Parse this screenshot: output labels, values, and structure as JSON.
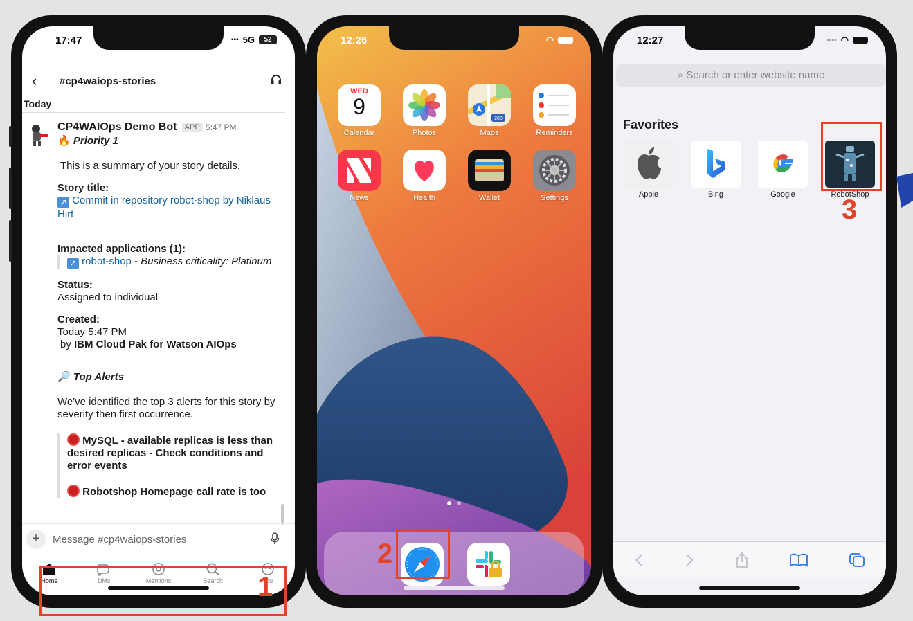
{
  "slack": {
    "status_time": "17:47",
    "network": "5G",
    "battery": "52",
    "channel": "#cp4waiops-stories",
    "day_label": "Today",
    "bot_name": "CP4WAIOps Demo Bot",
    "app_tag": "APP",
    "msg_time": "5:47 PM",
    "priority": "Priority 1",
    "summary": "This is a summary of your story details.",
    "story_title_label": "Story title:",
    "story_title_link": "Commit in repository robot-shop by Niklaus Hirt",
    "impacted_label": "Impacted applications (1):",
    "app_link": "robot-shop",
    "app_sep": " - ",
    "criticality": "Business criticality: Platinum",
    "status_label": "Status:",
    "status_value": "Assigned to individual",
    "created_label": "Created:",
    "created_value": "Today 5:47 PM",
    "by_prefix": "by",
    "by_value": "IBM Cloud Pak for Watson AIOps",
    "top_alerts": "Top Alerts",
    "alerts_intro": "We've identified the top 3 alerts for this story by severity then first occurrence.",
    "alert1": "MySQL - available replicas is less than desired replicas - Check conditions and error events",
    "alert2": "Robotshop Homepage call rate is too",
    "composer_placeholder": "Message #cp4waiops-stories",
    "tabs": [
      "Home",
      "DMs",
      "Mentions",
      "Search",
      "You"
    ]
  },
  "home": {
    "status_time": "12:26",
    "calendar_day": "WED",
    "calendar_date": "9",
    "maps_badge": "280",
    "apps": [
      "Calendar",
      "Photos",
      "Maps",
      "Reminders",
      "News",
      "Health",
      "Wallet",
      "Settings"
    ]
  },
  "safari": {
    "status_time": "12:27",
    "search_placeholder": "Search or enter website name",
    "favorites_title": "Favorites",
    "favorites": [
      "Apple",
      "Bing",
      "Google",
      "RobotShop"
    ]
  },
  "annotations": [
    "1",
    "2",
    "3"
  ],
  "colors": {
    "callout": "#e0442a",
    "link": "#1264a3",
    "slack_text": "#1d1c1d"
  }
}
